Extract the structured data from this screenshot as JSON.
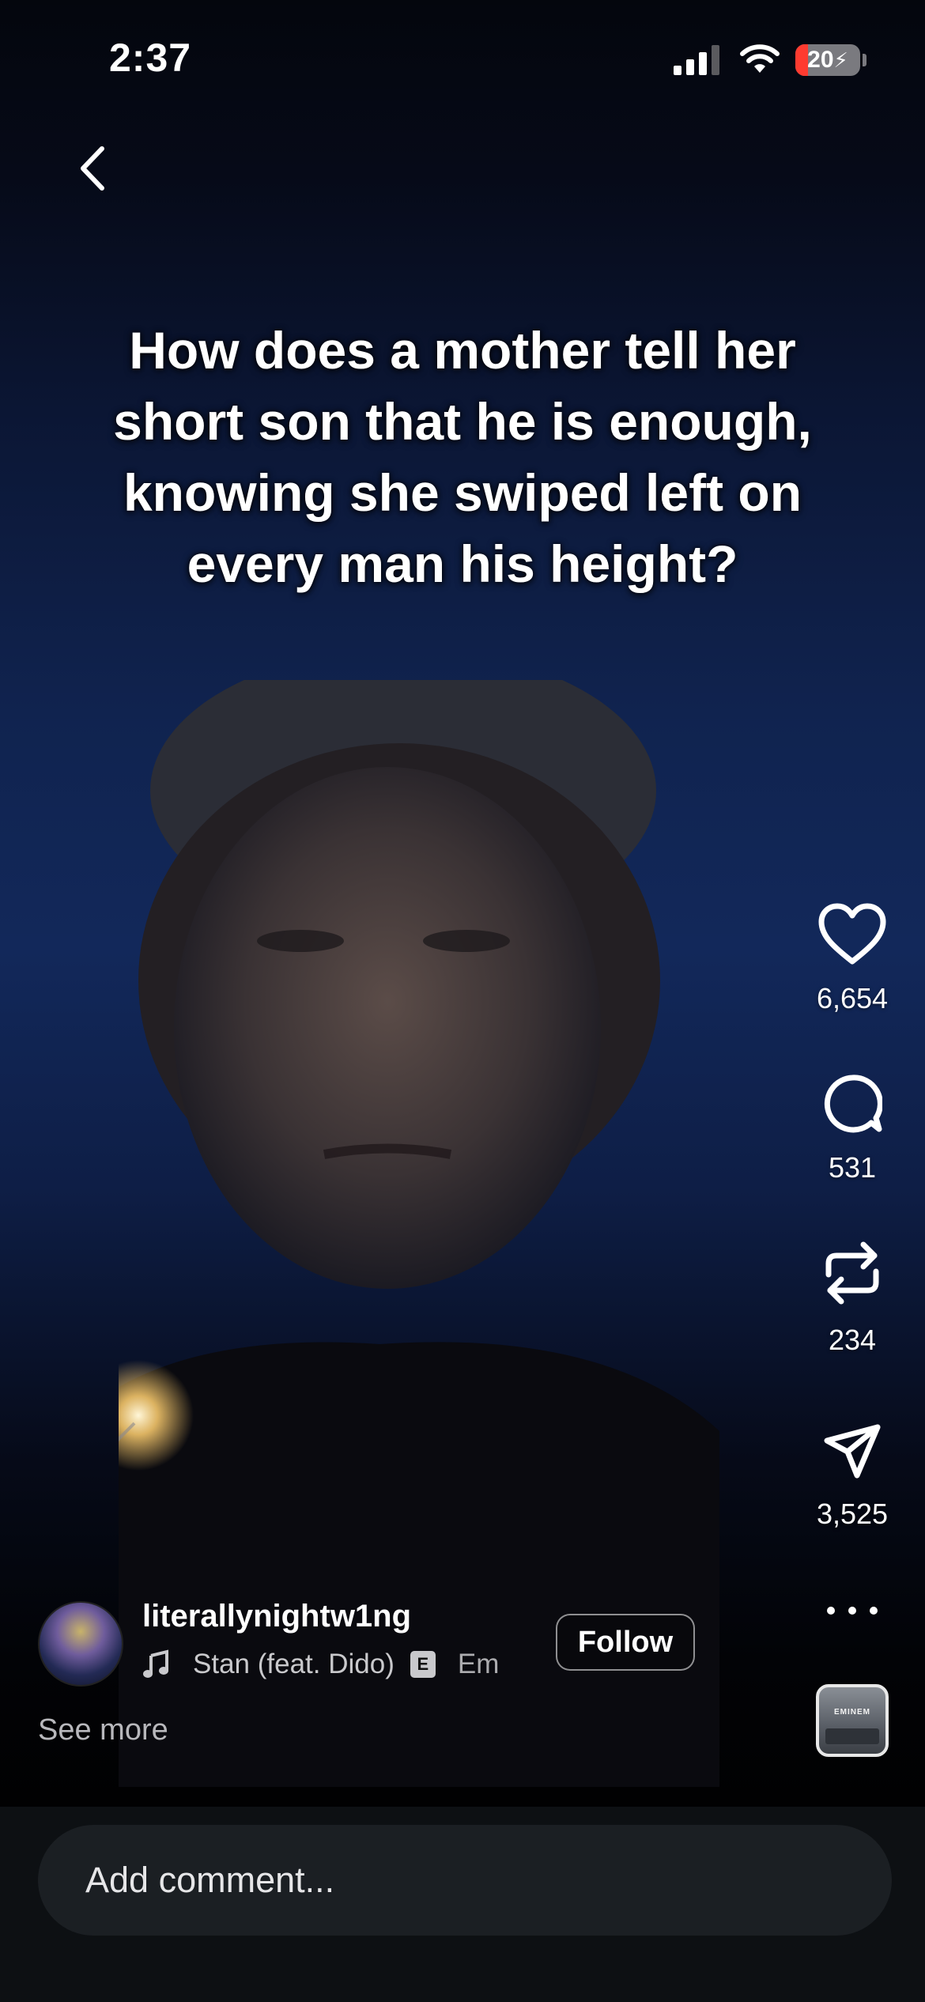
{
  "status_bar": {
    "time": "2:37",
    "battery": "20",
    "battery_level": 0.2,
    "battery_fill_color": "#ff3b30",
    "icons": [
      "cellular-signal-icon",
      "wifi-icon",
      "charging-bolt-icon"
    ]
  },
  "nav": {
    "back_icon": "chevron-left-icon"
  },
  "post": {
    "caption_overlay": "How does a mother tell her short son that he is enough, knowing she swiped left on every man his height?",
    "author": "literallynightw1ng",
    "music": {
      "icon": "music-note-icon",
      "title": "Stan (feat. Dido)",
      "explicit_label": "E",
      "artist_truncated": "Em"
    },
    "follow_label": "Follow",
    "see_more_label": "See more"
  },
  "actions": {
    "likes": "6,654",
    "comments": "531",
    "reposts": "234",
    "shares": "3,525",
    "more_icon": "more-horizontal-icon",
    "album_label": "EMINEM"
  },
  "comment_bar": {
    "placeholder": "Add comment..."
  }
}
